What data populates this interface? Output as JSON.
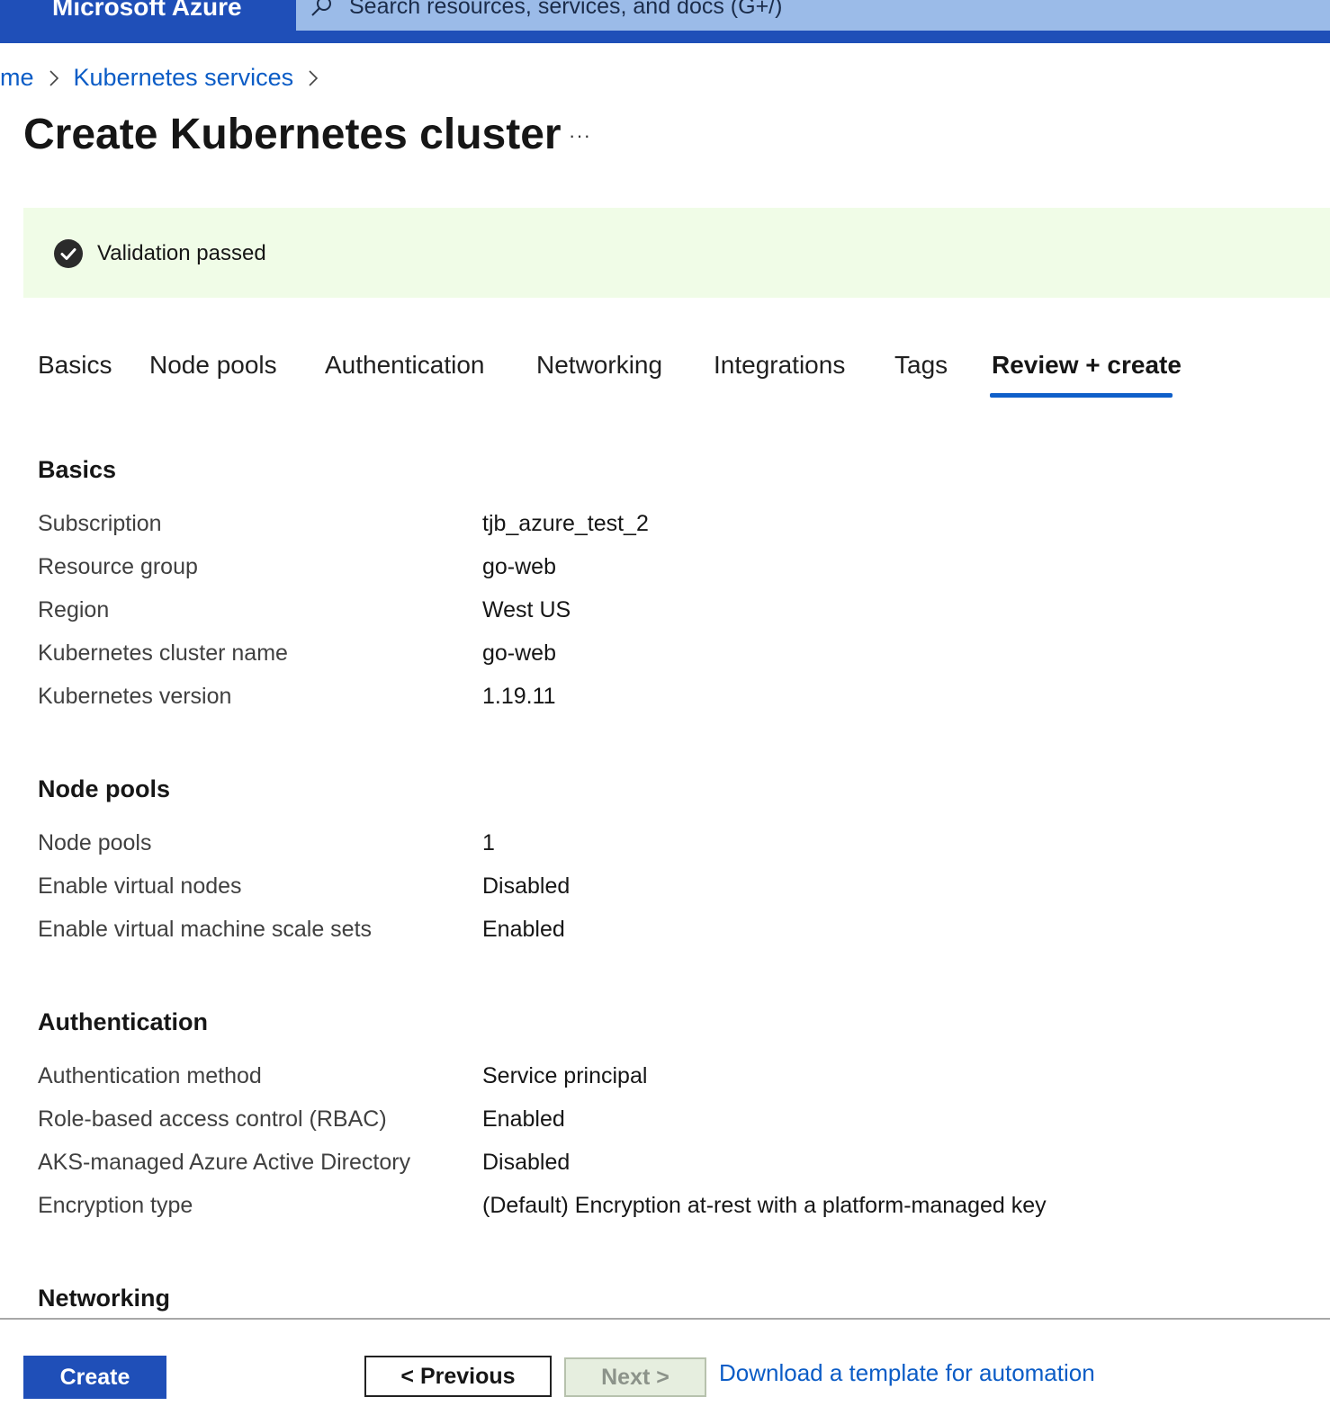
{
  "header": {
    "brand": "Microsoft Azure",
    "search_placeholder": "Search resources, services, and docs (G+/)",
    "color": "#1f4fb8"
  },
  "breadcrumb": {
    "items": [
      "me",
      "Kubernetes services"
    ]
  },
  "page": {
    "title": "Create Kubernetes cluster",
    "more": "···"
  },
  "banner": {
    "text": "Validation passed",
    "icon": "check-circle-icon"
  },
  "tabs": [
    {
      "label": "Basics"
    },
    {
      "label": "Node pools"
    },
    {
      "label": "Authentication"
    },
    {
      "label": "Networking"
    },
    {
      "label": "Integrations"
    },
    {
      "label": "Tags"
    },
    {
      "label": "Review + create",
      "active": true
    }
  ],
  "sections": {
    "basics": {
      "title": "Basics",
      "rows": [
        {
          "label": "Subscription",
          "value": "tjb_azure_test_2"
        },
        {
          "label": "Resource group",
          "value": "go-web"
        },
        {
          "label": "Region",
          "value": "West US"
        },
        {
          "label": "Kubernetes cluster name",
          "value": "go-web"
        },
        {
          "label": "Kubernetes version",
          "value": "1.19.11"
        }
      ]
    },
    "node_pools": {
      "title": "Node pools",
      "rows": [
        {
          "label": "Node pools",
          "value": "1"
        },
        {
          "label": "Enable virtual nodes",
          "value": "Disabled"
        },
        {
          "label": "Enable virtual machine scale sets",
          "value": "Enabled"
        }
      ]
    },
    "authentication": {
      "title": "Authentication",
      "rows": [
        {
          "label": "Authentication method",
          "value": "Service principal"
        },
        {
          "label": "Role-based access control (RBAC)",
          "value": "Enabled"
        },
        {
          "label": "AKS-managed Azure Active Directory",
          "value": "Disabled"
        },
        {
          "label": "Encryption type",
          "value": "(Default) Encryption at-rest with a platform-managed key"
        }
      ]
    },
    "networking": {
      "title": "Networking"
    }
  },
  "footer": {
    "create_label": "Create",
    "previous_label": "< Previous",
    "next_label": "Next >",
    "download_label": "Download a template for automation"
  }
}
